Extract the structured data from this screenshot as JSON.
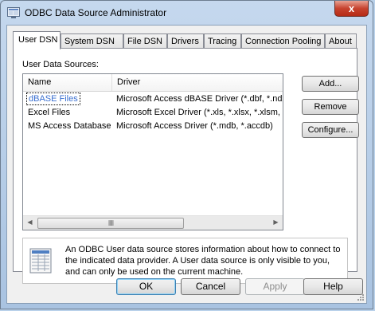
{
  "window": {
    "title": "ODBC Data Source Administrator",
    "close_glyph": "x"
  },
  "tabs": [
    {
      "label": "User DSN",
      "active": true
    },
    {
      "label": "System DSN",
      "active": false
    },
    {
      "label": "File DSN",
      "active": false
    },
    {
      "label": "Drivers",
      "active": false
    },
    {
      "label": "Tracing",
      "active": false
    },
    {
      "label": "Connection Pooling",
      "active": false
    },
    {
      "label": "About",
      "active": false
    }
  ],
  "panel": {
    "section_label": "User Data Sources:",
    "columns": {
      "name": "Name",
      "driver": "Driver"
    },
    "rows": [
      {
        "name": "dBASE Files",
        "driver": "Microsoft Access dBASE Driver (*.dbf, *.ndx",
        "selected": true
      },
      {
        "name": "Excel Files",
        "driver": "Microsoft Excel Driver (*.xls, *.xlsx, *.xlsm, *.x",
        "selected": false
      },
      {
        "name": "MS Access Database",
        "driver": "Microsoft Access Driver (*.mdb, *.accdb)",
        "selected": false
      }
    ],
    "scrollbar": {
      "left_arrow": "◀",
      "right_arrow": "▶",
      "grip": "⦀⦀"
    },
    "buttons": {
      "add": "Add...",
      "remove": "Remove",
      "configure": "Configure..."
    },
    "info_text": "An ODBC User data source stores information about how to connect to the indicated data provider.   A User data source is only visible to you, and can only be used on the current machine."
  },
  "footer": {
    "ok": "OK",
    "cancel": "Cancel",
    "apply": "Apply",
    "help": "Help"
  },
  "colors": {
    "selection_text": "#3a6fd0",
    "close_button": "#c7432f",
    "window_frame": "#b9d1ea"
  }
}
